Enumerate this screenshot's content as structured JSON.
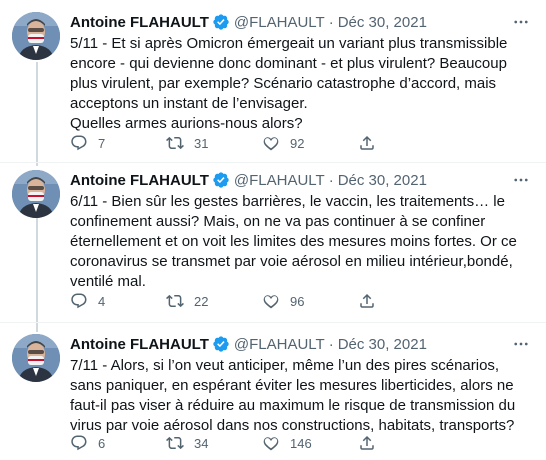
{
  "colors": {
    "text": "#0f1419",
    "muted": "#536471",
    "verified": "#1d9bf0",
    "border": "#eff3f4",
    "thread": "#cfd9de"
  },
  "tweets": [
    {
      "name": "Antoine FLAHAULT",
      "handle": "@FLAHAULT",
      "separator": "·",
      "date": "Déc 30, 2021",
      "text": "5/11 - Et si après Omicron émergeait un variant plus transmissible encore - qui devienne donc dominant - et plus virulent? Beaucoup plus virulent, par exemple? Scénario catastrophe d’accord, mais acceptons un instant de l’envisager.\nQuelles armes aurions-nous alors?",
      "replies": "7",
      "retweets": "31",
      "likes": "92"
    },
    {
      "name": "Antoine FLAHAULT",
      "handle": "@FLAHAULT",
      "separator": "·",
      "date": "Déc 30, 2021",
      "text": "6/11 - Bien sûr les gestes barrières, le vaccin, les traitements… le confinement aussi? Mais, on ne va pas continuer à se confiner éternellement et on voit les limites des mesures moins fortes. Or ce coronavirus se transmet par voie aérosol en milieu intérieur,bondé, ventilé mal.",
      "replies": "4",
      "retweets": "22",
      "likes": "96"
    },
    {
      "name": "Antoine FLAHAULT",
      "handle": "@FLAHAULT",
      "separator": "·",
      "date": "Déc 30, 2021",
      "text": "7/11 - Alors, si l’on veut anticiper, même l’un des pires scénarios, sans paniquer, en espérant éviter les mesures liberticides, alors ne faut-il pas viser à réduire au maximum le risque de transmission du virus par voie aérosol dans nos constructions, habitats, transports?",
      "replies": "6",
      "retweets": "34",
      "likes": "146"
    }
  ]
}
